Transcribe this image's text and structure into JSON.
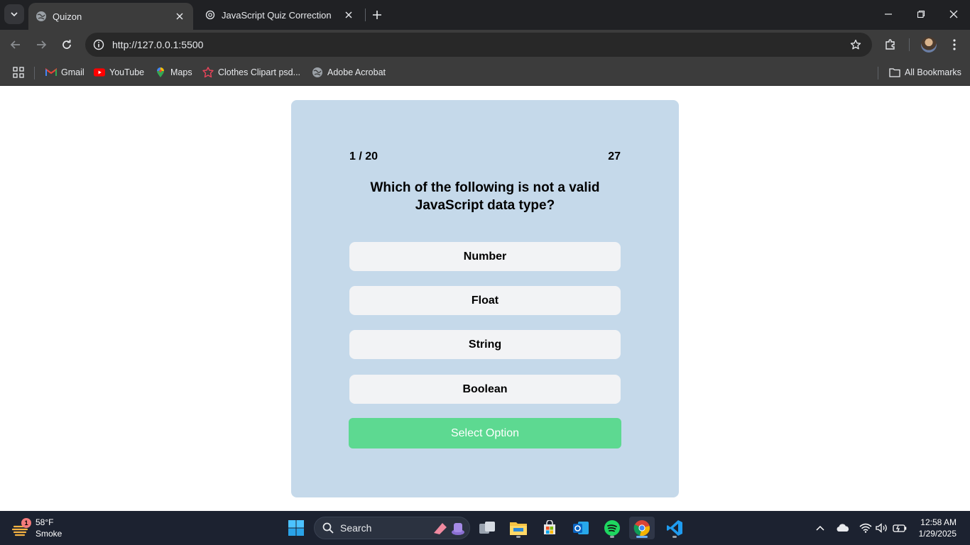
{
  "browser": {
    "tabs": [
      {
        "title": "Quizon",
        "active": true,
        "icon": "globe-icon"
      },
      {
        "title": "JavaScript Quiz Correction",
        "active": false,
        "icon": "openai-icon"
      }
    ],
    "url": "http://127.0.0.1:5500",
    "bookmarks": [
      {
        "label": "Gmail",
        "icon": "gmail-icon"
      },
      {
        "label": "YouTube",
        "icon": "youtube-icon"
      },
      {
        "label": "Maps",
        "icon": "maps-icon"
      },
      {
        "label": "Clothes Clipart psd...",
        "icon": "clipart-icon"
      },
      {
        "label": "Adobe Acrobat",
        "icon": "globe-icon"
      }
    ],
    "all_bookmarks_label": "All Bookmarks"
  },
  "quiz": {
    "counter": "1 / 20",
    "timer": "27",
    "question": "Which of the following is not a valid JavaScript data type?",
    "options": [
      "Number",
      "Float",
      "String",
      "Boolean"
    ],
    "submit_label": "Select Option",
    "card_color": "#c5d9ea",
    "submit_color": "#5dd991"
  },
  "taskbar": {
    "weather_temp": "58°F",
    "weather_desc": "Smoke",
    "weather_badge": "1",
    "search_label": "Search",
    "time": "12:58 AM",
    "date": "1/29/2025"
  }
}
